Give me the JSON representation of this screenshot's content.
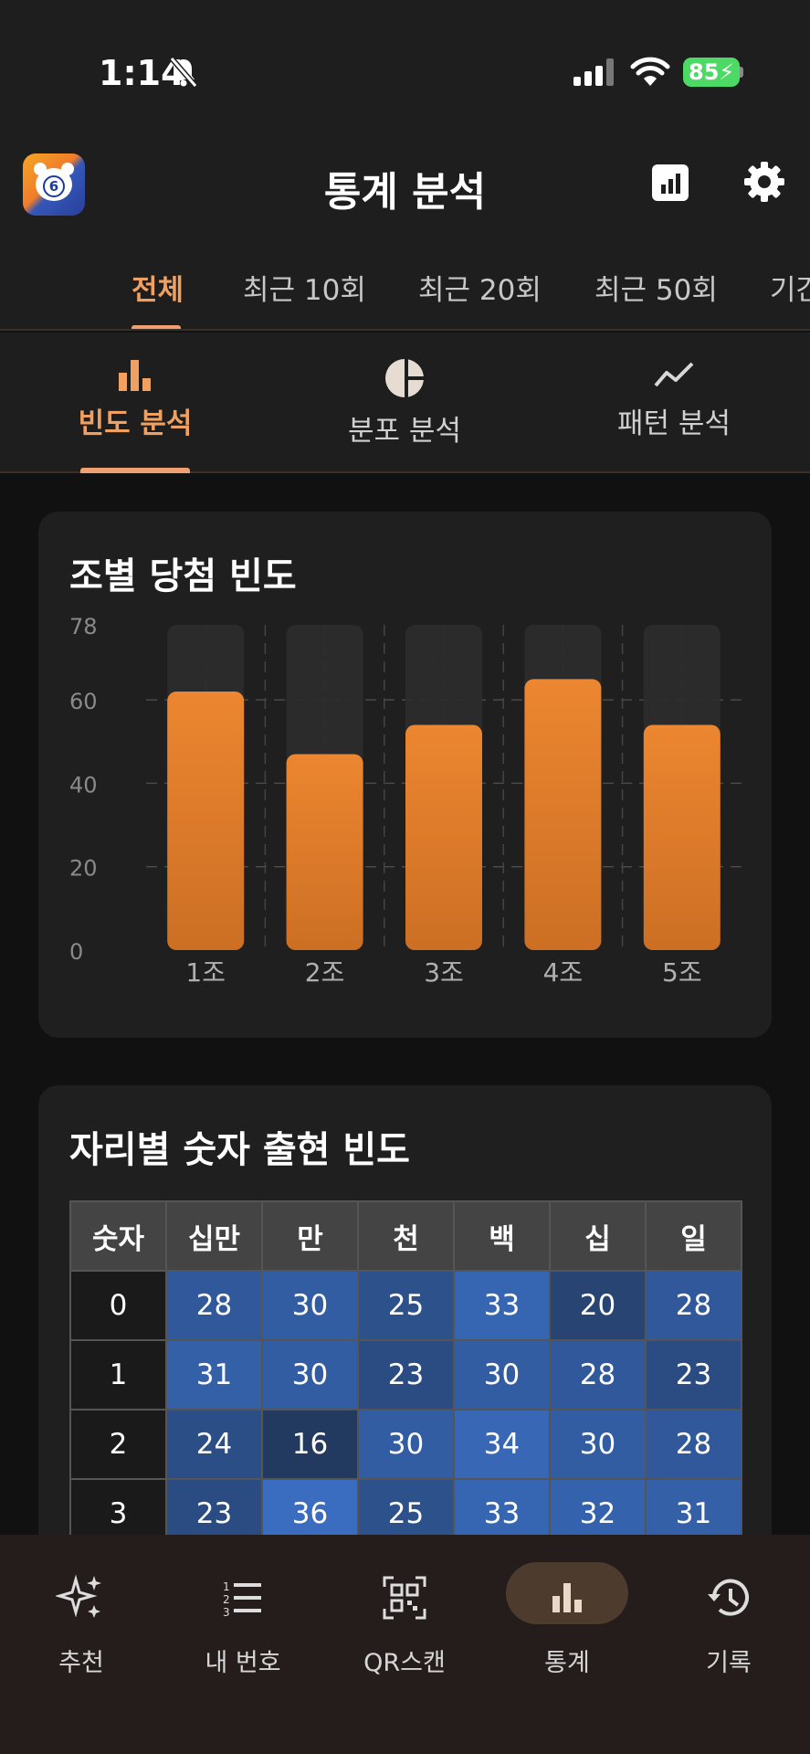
{
  "status": {
    "time": "1:14",
    "battery": "85"
  },
  "header": {
    "title": "통계 분석",
    "logo_number": "6"
  },
  "period_tabs": [
    "전체",
    "최근 10회",
    "최근 20회",
    "최근 50회",
    "기간"
  ],
  "analysis_tabs": [
    "빈도 분석",
    "분포 분석",
    "패턴 분석"
  ],
  "frequency_card": {
    "title": "조별 당첨 빈도"
  },
  "chart_data": {
    "type": "bar",
    "title": "조별 당첨 빈도",
    "categories": [
      "1조",
      "2조",
      "3조",
      "4조",
      "5조"
    ],
    "values": [
      62,
      47,
      54,
      65,
      54
    ],
    "ylim": [
      0,
      78
    ],
    "yticks": [
      0,
      20,
      40,
      60,
      78
    ],
    "grid": true,
    "bar_color": "#e8822f"
  },
  "position_card": {
    "title": "자리별 숫자 출현 빈도",
    "headers": [
      "숫자",
      "십만",
      "만",
      "천",
      "백",
      "십",
      "일"
    ],
    "rows": [
      {
        "digit": "0",
        "values": [
          "28",
          "30",
          "25",
          "33",
          "20",
          "28"
        ]
      },
      {
        "digit": "1",
        "values": [
          "31",
          "30",
          "23",
          "30",
          "28",
          "23"
        ]
      },
      {
        "digit": "2",
        "values": [
          "24",
          "16",
          "30",
          "34",
          "30",
          "28"
        ]
      },
      {
        "digit": "3",
        "values": [
          "23",
          "36",
          "25",
          "33",
          "32",
          "31"
        ]
      }
    ]
  },
  "bottom_nav": [
    "추천",
    "내 번호",
    "QR스캔",
    "통계",
    "기록"
  ],
  "colors": {
    "accent": "#f0a060",
    "bar": "#e8822f",
    "cell_high": "#3a6cc0",
    "cell_low": "#223a60"
  }
}
